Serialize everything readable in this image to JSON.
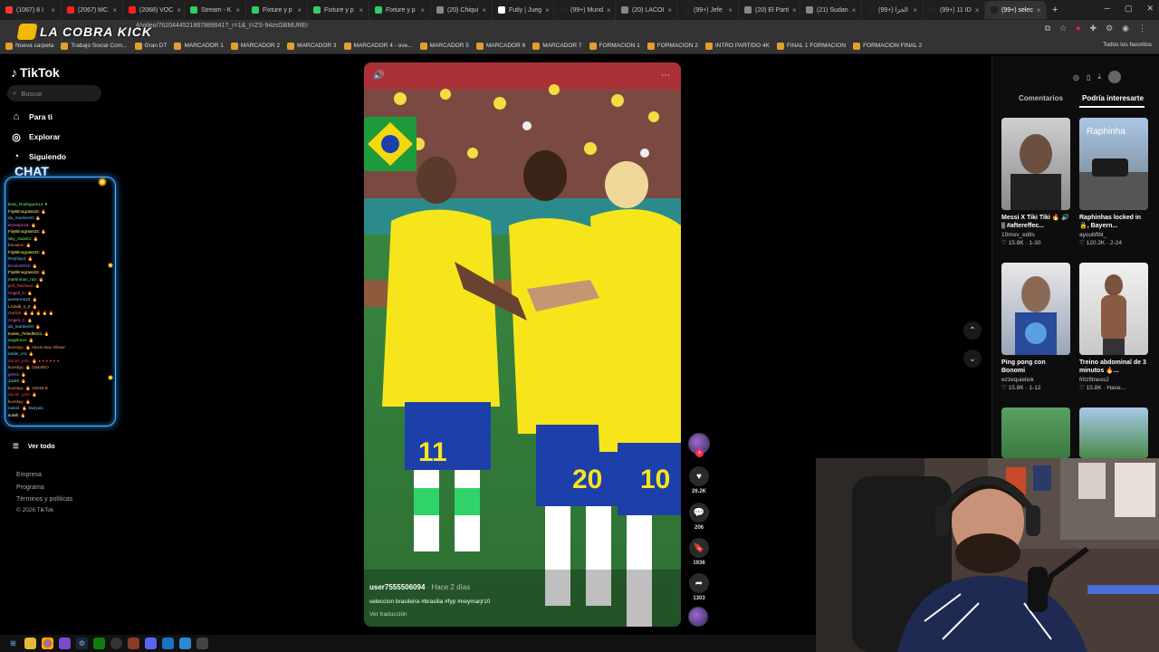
{
  "browser": {
    "tabs": [
      {
        "label": "(1067) 8 I",
        "color": "#ff3333"
      },
      {
        "label": "(2067) MC",
        "color": "#ff2020"
      },
      {
        "label": "(2068) VOC",
        "color": "#ff2020"
      },
      {
        "label": "Stream - K",
        "color": "#33cc66"
      },
      {
        "label": "Fixture y p",
        "color": "#33cc66"
      },
      {
        "label": "Fixture y p",
        "color": "#33cc66"
      },
      {
        "label": "Fixture y p",
        "color": "#33cc66"
      },
      {
        "label": "(20) Chiqui",
        "color": "#888888"
      },
      {
        "label": "Futly | Jueg",
        "color": "#ffffff"
      },
      {
        "label": "(99+) Mund",
        "color": "#222222"
      },
      {
        "label": "(20) LACOI",
        "color": "#888888"
      },
      {
        "label": "(99+) Jefe",
        "color": "#222222"
      },
      {
        "label": "(20) El Parti",
        "color": "#888888"
      },
      {
        "label": "(21) Sudan",
        "color": "#888888"
      },
      {
        "label": "(99+) الجزا",
        "color": "#222222"
      },
      {
        "label": "(99+) 11 ID",
        "color": "#222222"
      },
      {
        "label": "(99+) selec",
        "color": "#222222",
        "active": true
      }
    ],
    "url": "4/video/7620444521867889941?_r=1&_t=ZS-94zsGBMUREr",
    "bookmarks": [
      "Nueva carpeta",
      "Trabajo Social Com...",
      "Gran DT",
      "MARCADOR 1",
      "MARCADOR 2",
      "MARCADOR 3",
      "MARCADOR 4 - ove...",
      "MARCADOR 5",
      "MARCADOR 6",
      "MARCADOR 7",
      "FORMACION 1",
      "FORMACION 2",
      "INTRO PARTIDO 4K",
      "FINAL 1 FORMACION",
      "FORMACION FINAL 2"
    ],
    "bookmarks_right": "Todos los favoritos"
  },
  "overlay": {
    "logo_text": "LA COBRA KICK",
    "chat_title": "CHAT",
    "chat_lines": [
      {
        "text": "Dani_Rodrigues14: ♥",
        "color": "#66ff66"
      },
      {
        "text": "FiiyBlinograss22: 🔥",
        "color": "#ffff66"
      },
      {
        "text": "da_martinez0: 🔥",
        "color": "#66ccff"
      },
      {
        "text": "elcrespo16: 🔥",
        "color": "#ff66cc"
      },
      {
        "text": "FiiyBlinograss22: 🔥",
        "color": "#ffff66"
      },
      {
        "text": "Sky_Juanito: 🔥",
        "color": "#66ff66"
      },
      {
        "text": "bocasoc: 🔥",
        "color": "#ff9966"
      },
      {
        "text": "FiiyBlinograss22: 🔥",
        "color": "#ffff66"
      },
      {
        "text": "Reyblay2: 🔥",
        "color": "#66ccff"
      },
      {
        "text": "brooks0815: 🔥",
        "color": "#cc66ff"
      },
      {
        "text": "FiiyBlinograss22: 🔥",
        "color": "#ffff66"
      },
      {
        "text": "martinmon_rub: 🔥",
        "color": "#66ff99"
      },
      {
        "text": "yoli_Pacheco: 🔥",
        "color": "#ff6666"
      },
      {
        "text": "Angeli_C: 🔥",
        "color": "#ff66cc"
      },
      {
        "text": "avetorres10: 🔥",
        "color": "#66ccff"
      },
      {
        "text": "LAmidi_s_2: 🔥",
        "color": "#ffcc66"
      },
      {
        "text": "Garlick: 🔥 🔥 🔥 🔥 🔥",
        "color": "#ff6666"
      },
      {
        "text": "Angeli_C: 🔥",
        "color": "#ff66cc"
      },
      {
        "text": "da_martinez0: 🔥",
        "color": "#66ccff"
      },
      {
        "text": "Kalvin_Peledfer21: 🔥",
        "color": "#ffff66"
      },
      {
        "text": "angelrexx: 🔥",
        "color": "#66ff66"
      },
      {
        "text": "kunskyy: 🔥 Alexis Mac Allister",
        "color": "#ff9966"
      },
      {
        "text": "eddie_cnt: 🔥",
        "color": "#66ccff"
      },
      {
        "text": "daniel_pafo: 🔥 ● ● ● ● ● ●",
        "color": "#ff3333"
      },
      {
        "text": "kunskyy: 🔥 DjMaRiO",
        "color": "#ff9966"
      },
      {
        "text": "gilmik: 🔥",
        "color": "#cc66ff"
      },
      {
        "text": "Jackil: 🔥",
        "color": "#66ff99"
      },
      {
        "text": "kunskyy: 🔥 JefeDLB",
        "color": "#ff9966"
      },
      {
        "text": "daniel_pafo: 🔥",
        "color": "#ff3333"
      },
      {
        "text": "kunskyy: 🔥",
        "color": "#ff9966"
      },
      {
        "text": "nait44: 🔥 Staryuki",
        "color": "#66ccff"
      },
      {
        "text": "solvili: 🔥",
        "color": "#ffffff"
      }
    ]
  },
  "tiktok": {
    "logo": "TikTok",
    "search_placeholder": "Buscar",
    "nav": {
      "for_you": "Para ti",
      "explore": "Explorar",
      "following": "Siguiendo",
      "see_all": "Ver todo"
    },
    "footer": {
      "company": "Empresa",
      "program": "Programa",
      "terms": "Términos y políticas",
      "copyright": "© 2026 TikTok"
    },
    "video": {
      "username": "user7555506094",
      "time": " · Hace 2 días",
      "caption": "seleccion brasileira #brasilia #fyp #neymarjr10",
      "translate": "Ver traducción"
    },
    "actions": {
      "likes": "26.2K",
      "comments": "206",
      "saves": "1936",
      "shares": "1303"
    },
    "right": {
      "tab_comments": "Comentarios",
      "tab_interest": "Podría interesarte",
      "cards": [
        {
          "title": "Messi X Tiki Tiki 🔥 🔊 || #aftereffec...",
          "author": "10mov_edits",
          "likes": "15.8K",
          "when": "1-30",
          "thumb_label": ""
        },
        {
          "title": "Raphinhas locked in 🔒, Bayern...",
          "author": "ayoubftbl_",
          "likes": "120.2K",
          "when": "2-24",
          "thumb_label": "Raphinha"
        },
        {
          "title": "Ping pong con Bonomi",
          "author": "ezzequieliok",
          "likes": "15.8K",
          "when": "1-12",
          "thumb_label": ""
        },
        {
          "title": "Treino abdominal de 3 minutos 🔥...",
          "author": "fritzfitness2",
          "likes": "15.8K",
          "when": "Hace...",
          "thumb_label": ""
        }
      ]
    }
  },
  "colors": {
    "accent": "#fe2c55",
    "chat_border": "#58b8ff",
    "brazil_yellow": "#f7e51b",
    "brazil_blue": "#1d3faa"
  }
}
